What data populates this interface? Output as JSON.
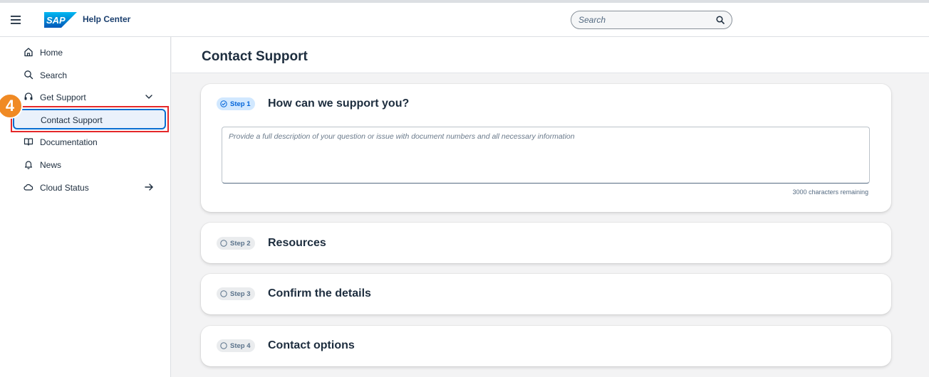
{
  "app": {
    "title": "Help Center",
    "logo_text": "SAP",
    "brand_color": "#0a6ed1"
  },
  "search": {
    "placeholder": "Search"
  },
  "sidebar": {
    "items": [
      {
        "label": "Home",
        "icon": "home-icon"
      },
      {
        "label": "Search",
        "icon": "search-icon"
      },
      {
        "label": "Get Support",
        "icon": "headset-icon",
        "trailing_icon": "chevron-down-icon",
        "expanded": true
      },
      {
        "label": "Documentation",
        "icon": "book-icon"
      },
      {
        "label": "News",
        "icon": "bell-icon"
      },
      {
        "label": "Cloud Status",
        "icon": "cloud-icon",
        "trailing_icon": "arrow-right-icon"
      }
    ],
    "sub_items": [
      {
        "label": "Contact Support",
        "selected": true
      }
    ]
  },
  "annotation": {
    "step_number": "4",
    "marker_color": "#f08a24",
    "highlight_color": "#e5282a"
  },
  "page": {
    "title": "Contact Support"
  },
  "steps": [
    {
      "badge": "Step 1",
      "title": "How can we support you?",
      "state": "active",
      "icon": "check-circle-icon"
    },
    {
      "badge": "Step 2",
      "title": "Resources",
      "state": "inactive",
      "icon": "circle-icon"
    },
    {
      "badge": "Step 3",
      "title": "Confirm the details",
      "state": "inactive",
      "icon": "circle-icon"
    },
    {
      "badge": "Step 4",
      "title": "Contact options",
      "state": "inactive",
      "icon": "circle-icon"
    }
  ],
  "description": {
    "placeholder": "Provide a full description of your question or issue with document numbers and all necessary information",
    "value": "",
    "char_remaining": "3000 characters remaining"
  }
}
